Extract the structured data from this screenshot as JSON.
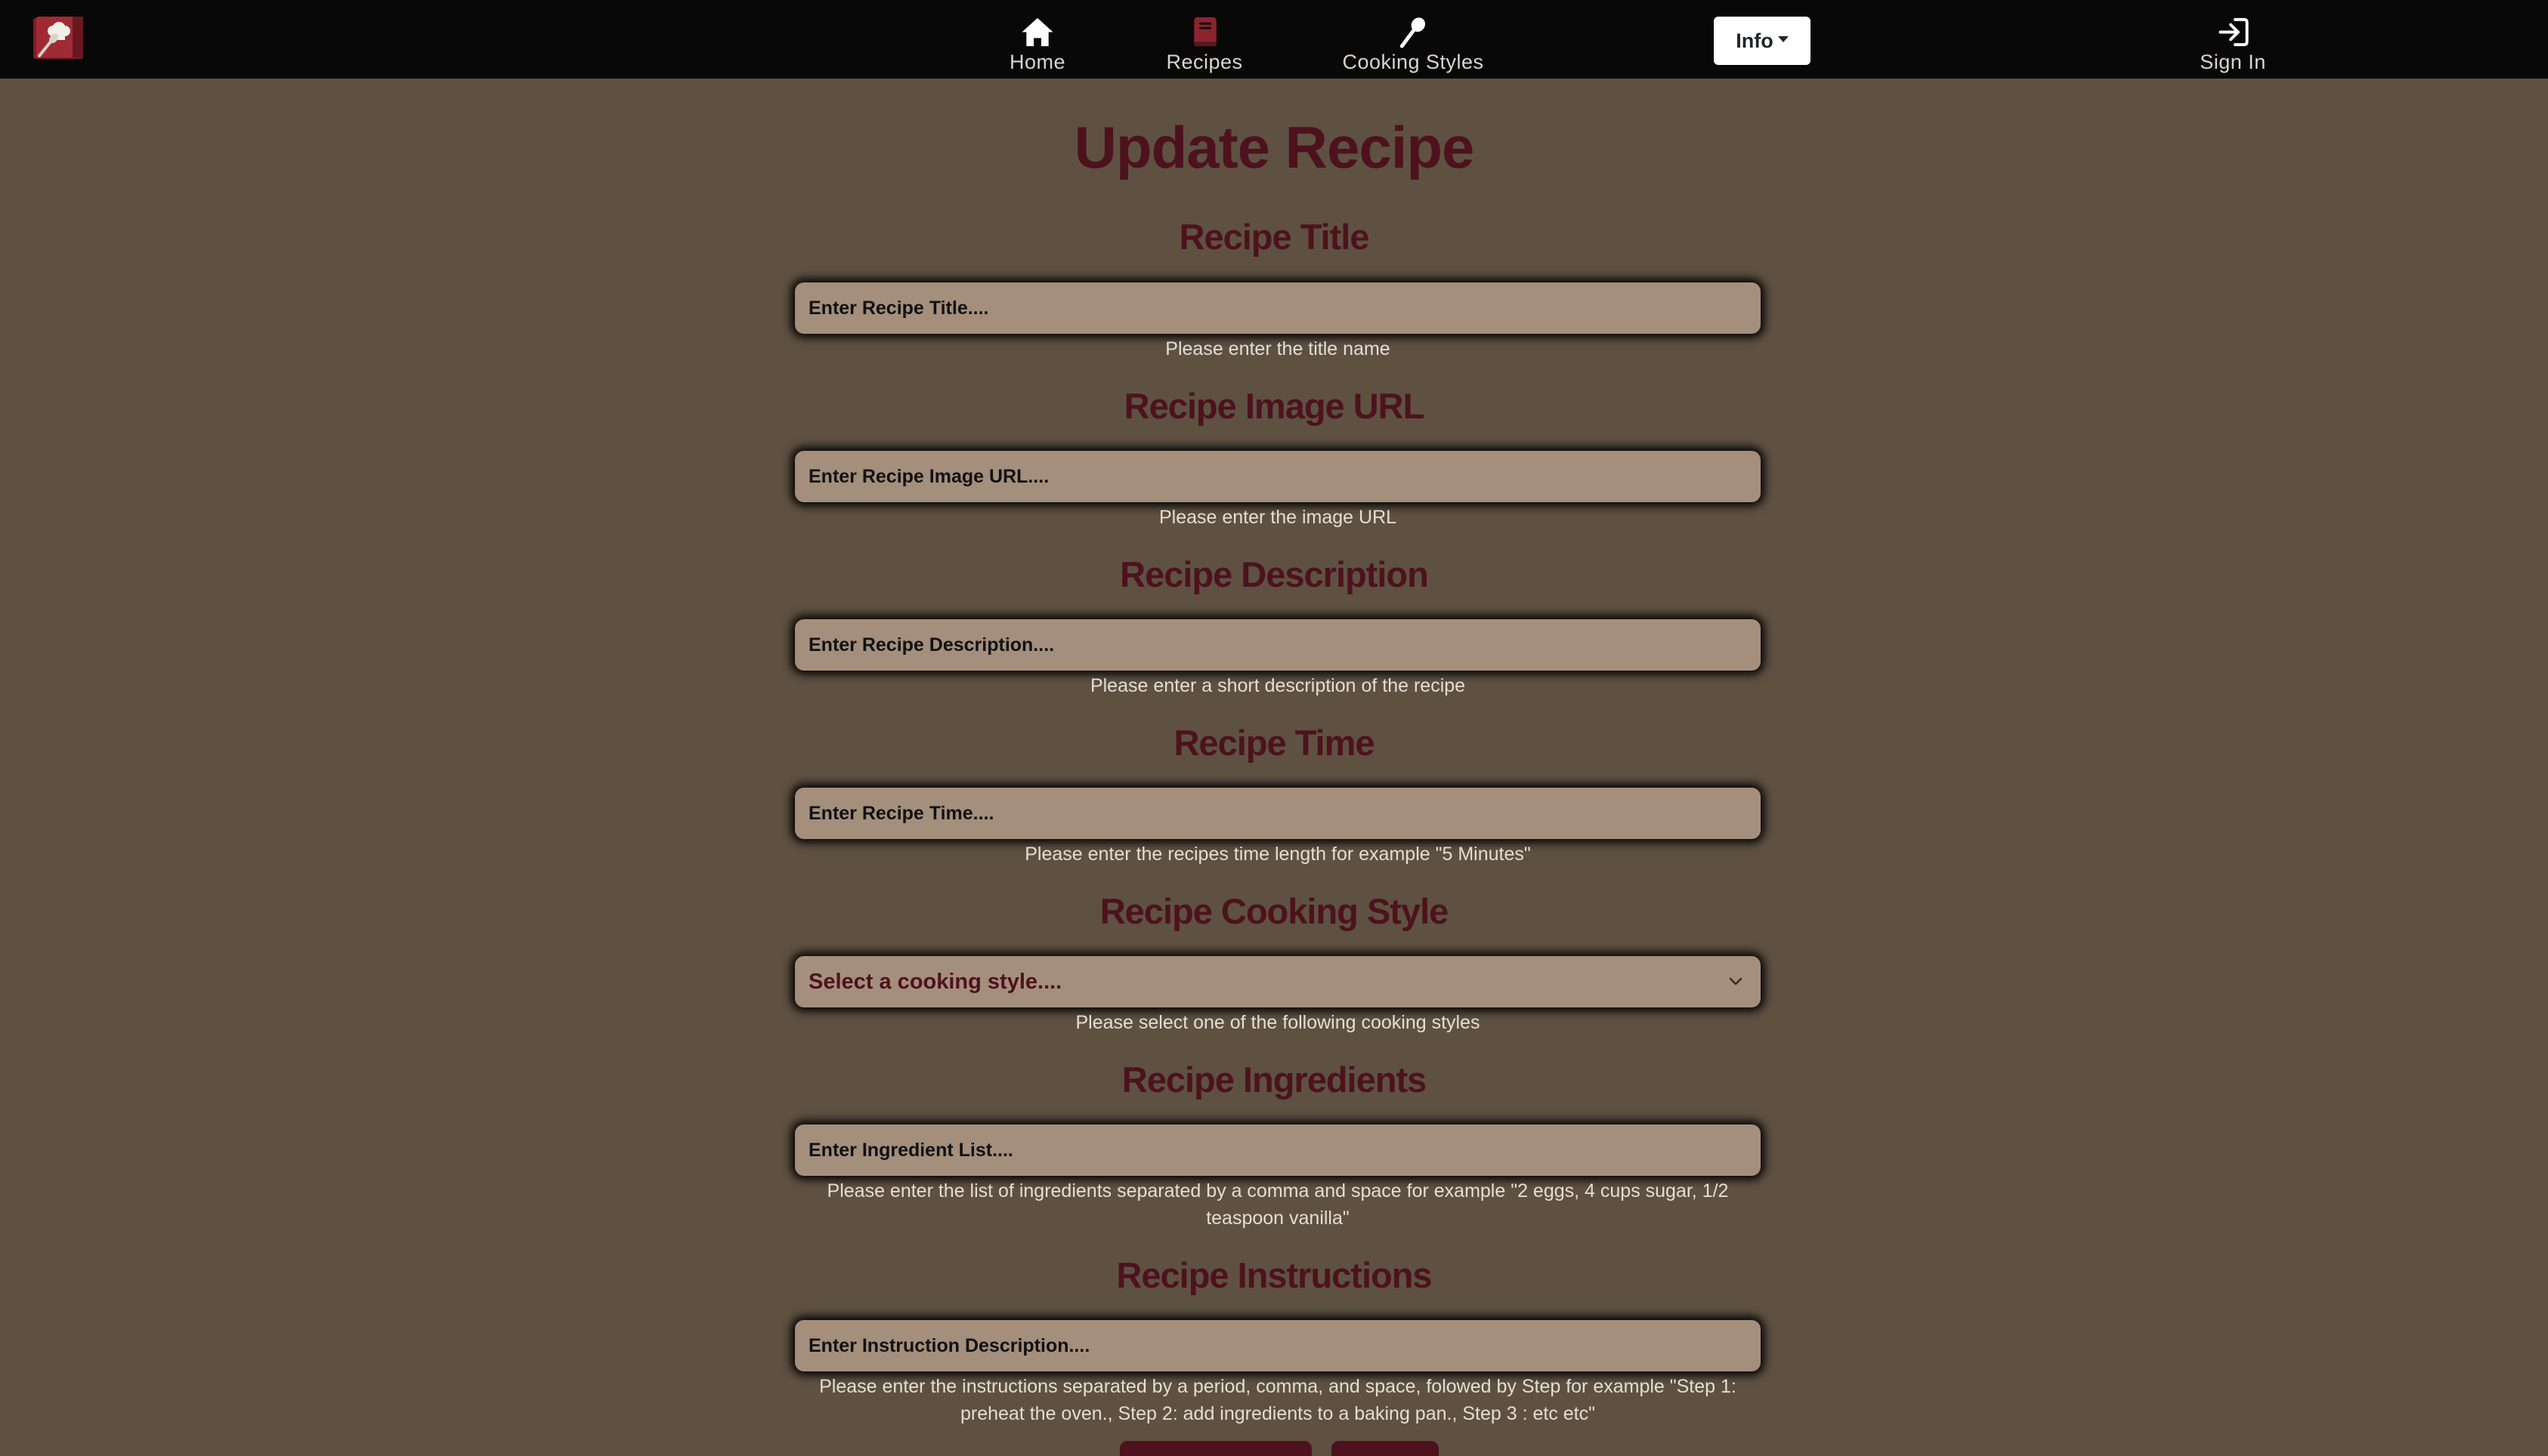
{
  "nav": {
    "home_label": "Home",
    "recipes_label": "Recipes",
    "styles_label": "Cooking Styles",
    "info_label": "Info",
    "signin_label": "Sign In"
  },
  "form": {
    "page_title": "Update Recipe",
    "title": {
      "heading": "Recipe Title",
      "placeholder": "Enter Recipe Title....",
      "help": "Please enter the title name"
    },
    "image_url": {
      "heading": "Recipe Image URL",
      "placeholder": "Enter Recipe Image URL....",
      "help": "Please enter the image URL"
    },
    "description": {
      "heading": "Recipe Description",
      "placeholder": "Enter Recipe Description....",
      "help": "Please enter a short description of the recipe"
    },
    "time": {
      "heading": "Recipe Time",
      "placeholder": "Enter Recipe Time....",
      "help": "Please enter the recipes time length for example \"5 Minutes\""
    },
    "cooking_style": {
      "heading": "Recipe Cooking Style",
      "selected": "Select a cooking style....",
      "help": "Please select one of the following cooking styles"
    },
    "ingredients": {
      "heading": "Recipe Ingredients",
      "placeholder": "Enter Ingredient List....",
      "help": "Please enter the list of ingredients separated by a comma and space for example \"2 eggs, 4 cups sugar, 1/2 teaspoon vanilla\""
    },
    "instructions": {
      "heading": "Recipe Instructions",
      "placeholder": "Enter Instruction Description....",
      "help": "Please enter the instructions separated by a period, comma, and space, folowed by Step for example \"Step 1: preheat the oven., Step 2: add ingredients to a baking pan., Step 3 : etc etc\""
    }
  },
  "colors": {
    "background": "#5e5142",
    "navbar": "#090808",
    "heading": "#4d121d",
    "field": "#a48f7c",
    "help_text": "#e4ddd3"
  },
  "icons": {
    "logo": "chef-book-logo",
    "home": "house-icon",
    "recipes": "book-icon",
    "styles": "spoon-icon",
    "signin": "sign-in-icon",
    "select": "chevron-down-icon"
  }
}
